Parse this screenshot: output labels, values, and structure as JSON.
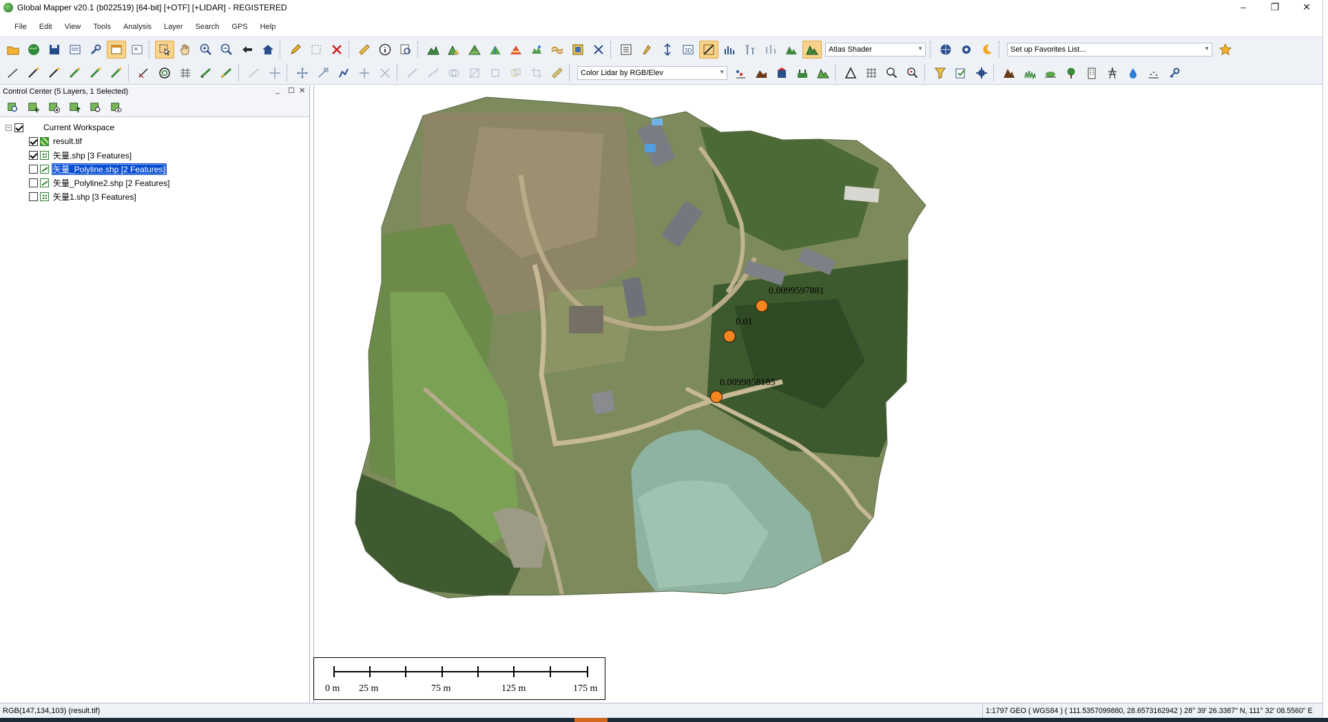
{
  "window": {
    "title": "Global Mapper v20.1 (b022519) [64-bit] [+OTF] [+LIDAR] - REGISTERED",
    "minimize": "–",
    "restore": "❐",
    "close": "✕"
  },
  "menu": [
    "File",
    "Edit",
    "View",
    "Tools",
    "Analysis",
    "Layer",
    "Search",
    "GPS",
    "Help"
  ],
  "toolbar": {
    "shader_select": "Atlas Shader",
    "favorites_select": "Set up Favorites List...",
    "lidar_color_select": "Color Lidar by RGB/Elev"
  },
  "control_center": {
    "title": "Control Center (5 Layers, 1 Selected)",
    "workspace": "Current Workspace",
    "layers": [
      {
        "name": "result.tif",
        "checked": true,
        "type": "raster",
        "selected": false
      },
      {
        "name": "矢量.shp [3 Features]",
        "checked": true,
        "type": "point",
        "selected": false
      },
      {
        "name": "矢量_Polyline.shp [2 Features]",
        "checked": false,
        "type": "line",
        "selected": true
      },
      {
        "name": "矢量_Polyline2.shp [2 Features]",
        "checked": false,
        "type": "line",
        "selected": false
      },
      {
        "name": "矢量1.shp [3 Features]",
        "checked": false,
        "type": "point",
        "selected": false
      }
    ]
  },
  "map": {
    "points": [
      {
        "label": "0.0099597881"
      },
      {
        "label": "0.01"
      },
      {
        "label": "0.0099858185"
      }
    ],
    "point_color": "#f5851f",
    "scale_labels": [
      "0 m",
      "25 m",
      "75 m",
      "125 m",
      "175 m"
    ]
  },
  "status": {
    "pixel_info": "RGB(147,134,103) (result.tif)",
    "coords": "1:1797  GEO ( WGS84 ) ( 111.5357099880, 28.6573162942 )  28° 39' 26.3387\" N, 111° 32' 08.5560\" E"
  }
}
